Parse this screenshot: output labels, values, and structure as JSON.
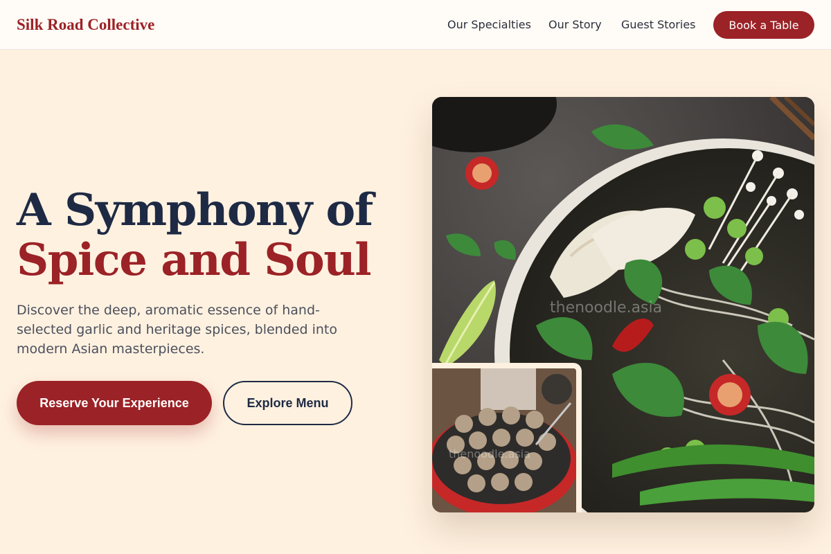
{
  "header": {
    "brand": "Silk Road Collective",
    "nav": [
      "Our Specialties",
      "Our Story",
      "Guest Stories"
    ],
    "cta": "Book a Table"
  },
  "hero": {
    "title_line1": "A Symphony of",
    "title_line2": "Spice and Soul",
    "subtitle": "Discover the deep, aromatic essence of hand-selected garlic and heritage spices, blended into modern Asian masterpieces.",
    "primary_button": "Reserve Your Experience",
    "secondary_button": "Explore Menu"
  },
  "images": {
    "main": {
      "subject": "noodle-soup-bowl-photo",
      "watermark": "thenoodle.asia"
    },
    "inset": {
      "subject": "takoyaki-pan-photo",
      "watermark": "thenoodle.asia"
    }
  },
  "colors": {
    "accent": "#9b2226",
    "navy": "#1e2a44",
    "background": "#fff1e0",
    "header_bg": "#fffbf7"
  }
}
